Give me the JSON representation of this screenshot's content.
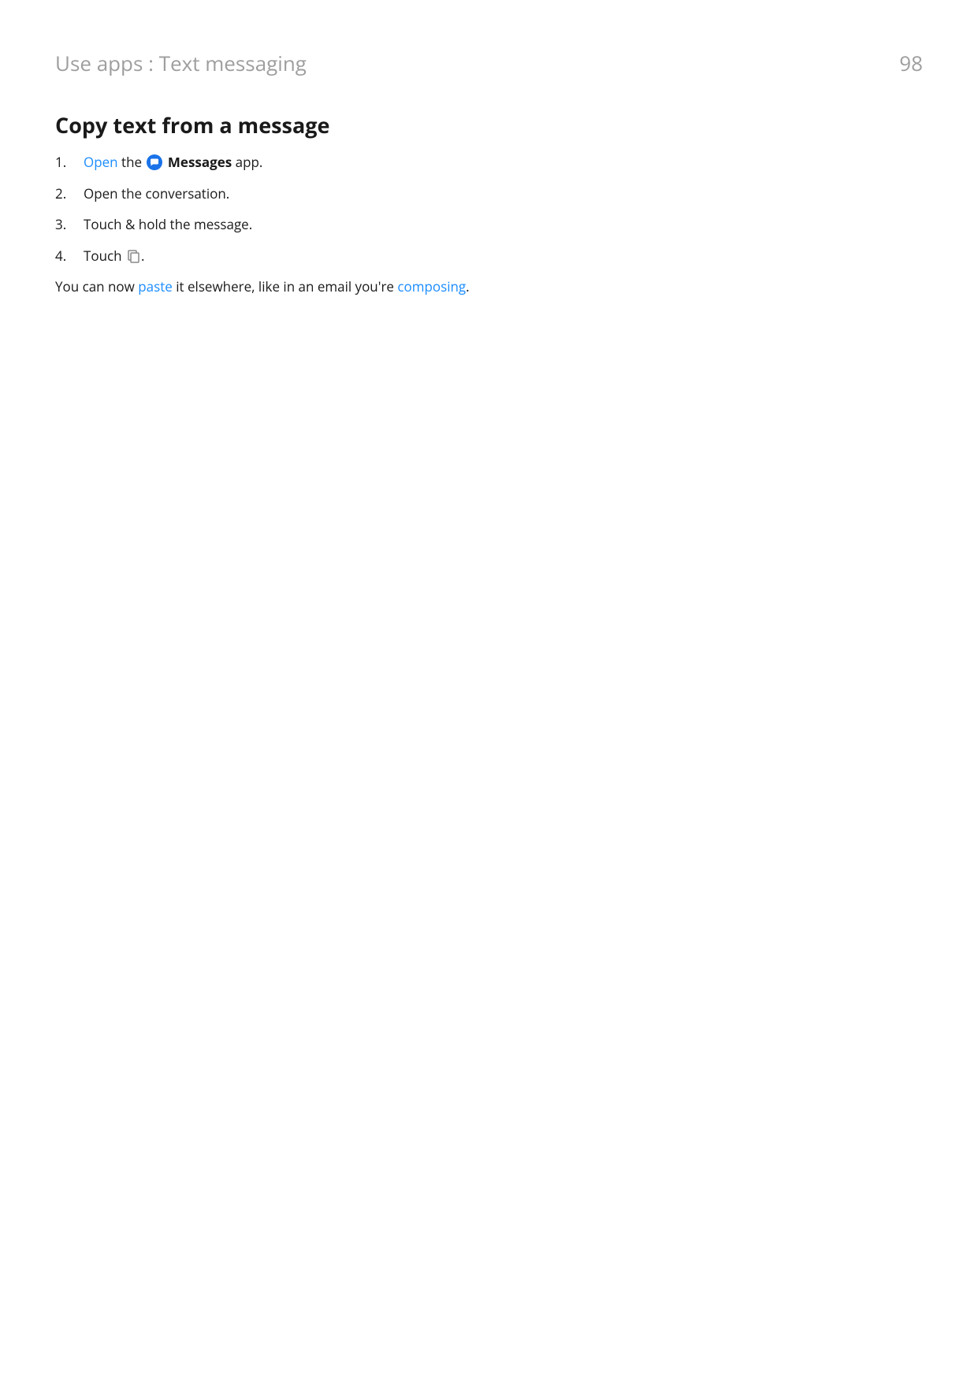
{
  "header": {
    "breadcrumb": "Use apps : Text messaging",
    "page_number": "98"
  },
  "section": {
    "title": "Copy text from a message",
    "step1": {
      "link": "Open",
      "text_before_icon": " the ",
      "bold_app_name": "Messages",
      "text_after": " app."
    },
    "step2": "Open the conversation.",
    "step3": "Touch & hold the message.",
    "step4": {
      "text_before": "Touch ",
      "text_after": "."
    },
    "closing": {
      "text1": "You can now ",
      "link1": "paste",
      "text2": " it elsewhere, like in an email you're ",
      "link2": "composing",
      "text3": "."
    }
  }
}
